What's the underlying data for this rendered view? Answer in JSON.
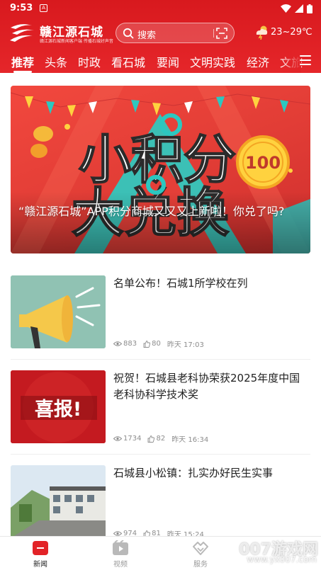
{
  "status_bar": {
    "time": "9:53",
    "app_icon_letter": "A"
  },
  "header": {
    "logo_name": "赣江源石城",
    "logo_sub": "赣江源石城新闻客户端 传播石城好声音",
    "search_placeholder": "搜索",
    "weather": "23~29℃"
  },
  "tabs": [
    {
      "label": "推荐",
      "active": true
    },
    {
      "label": "头条"
    },
    {
      "label": "时政"
    },
    {
      "label": "看石城"
    },
    {
      "label": "要闻"
    },
    {
      "label": "文明实践"
    },
    {
      "label": "经济"
    },
    {
      "label": "文旅"
    }
  ],
  "hero": {
    "title": "“赣江源石城”APP积分商城又又又上新啦！你兑了吗?",
    "image_text": "小积分大兑换",
    "badge": "100"
  },
  "articles": [
    {
      "title": "名单公布！石城1所学校在列",
      "views": "883",
      "likes": "80",
      "time": "昨天 17:03"
    },
    {
      "title": "祝贺！石城县老科协荣获2025年度中国老科协科学技术奖",
      "views": "1734",
      "likes": "82",
      "time": "昨天 16:34",
      "thumb_text": "喜报!"
    },
    {
      "title": "石城县小松镇：扎实办好民生实事",
      "views": "974",
      "likes": "81",
      "time": "昨天 15:24"
    }
  ],
  "bottom_nav": [
    {
      "label": "新闻",
      "active": true
    },
    {
      "label": "视频"
    },
    {
      "label": "服务"
    }
  ],
  "watermark": {
    "main": "007游戏网",
    "sub": "www.yx007.com"
  },
  "colors": {
    "brand_red": "#e22327",
    "meta_gray": "#8d8d8d",
    "inactive_nav": "#9a9a9a"
  }
}
